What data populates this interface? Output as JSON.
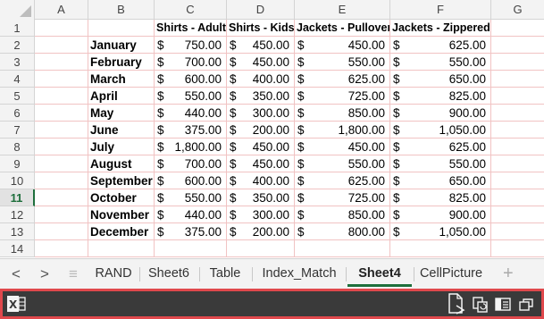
{
  "columns": [
    "A",
    "B",
    "C",
    "D",
    "E",
    "F",
    "G"
  ],
  "rows": [
    "1",
    "2",
    "3",
    "4",
    "5",
    "6",
    "7",
    "8",
    "9",
    "10",
    "11",
    "12",
    "13",
    "14"
  ],
  "active_row": "11",
  "headers": [
    "Shirts - Adult",
    "Shirts - Kids",
    "Jackets - Pullover",
    "Jackets - Zippered"
  ],
  "currency": "$",
  "data_rows": [
    {
      "month": "January",
      "c": "750.00",
      "d": "450.00",
      "e": "450.00",
      "f": "625.00"
    },
    {
      "month": "February",
      "c": "700.00",
      "d": "450.00",
      "e": "550.00",
      "f": "550.00"
    },
    {
      "month": "March",
      "c": "600.00",
      "d": "400.00",
      "e": "625.00",
      "f": "650.00"
    },
    {
      "month": "April",
      "c": "550.00",
      "d": "350.00",
      "e": "725.00",
      "f": "825.00"
    },
    {
      "month": "May",
      "c": "440.00",
      "d": "300.00",
      "e": "850.00",
      "f": "900.00"
    },
    {
      "month": "June",
      "c": "375.00",
      "d": "200.00",
      "e": "1,800.00",
      "f": "1,050.00"
    },
    {
      "month": "July",
      "c": "1,800.00",
      "d": "450.00",
      "e": "450.00",
      "f": "625.00"
    },
    {
      "month": "August",
      "c": "700.00",
      "d": "450.00",
      "e": "550.00",
      "f": "550.00"
    },
    {
      "month": "September",
      "c": "600.00",
      "d": "400.00",
      "e": "625.00",
      "f": "650.00"
    },
    {
      "month": "October",
      "c": "550.00",
      "d": "350.00",
      "e": "725.00",
      "f": "825.00"
    },
    {
      "month": "November",
      "c": "440.00",
      "d": "300.00",
      "e": "850.00",
      "f": "900.00"
    },
    {
      "month": "December",
      "c": "375.00",
      "d": "200.00",
      "e": "800.00",
      "f": "1,050.00"
    }
  ],
  "nav": {
    "prev": "<",
    "next": ">",
    "menu": "≡"
  },
  "tabs": [
    {
      "label": "RAND",
      "active": false
    },
    {
      "label": "Sheet6",
      "active": false
    },
    {
      "label": "Table",
      "active": false
    },
    {
      "label": "Index_Match",
      "active": false
    },
    {
      "label": "Sheet4",
      "active": true
    },
    {
      "label": "CellPicture",
      "active": false
    }
  ],
  "add_sheet": "+",
  "colors": {
    "accent": "#1e6f3c",
    "statusbar_border": "#e0484c",
    "statusbar_bg": "#3a3a3a",
    "gridline": "#f1c3c3"
  },
  "icons": {
    "app": "excel-icon",
    "status": [
      "document-icon",
      "copy-icon",
      "sidebar-view-icon",
      "restore-window-icon"
    ]
  }
}
